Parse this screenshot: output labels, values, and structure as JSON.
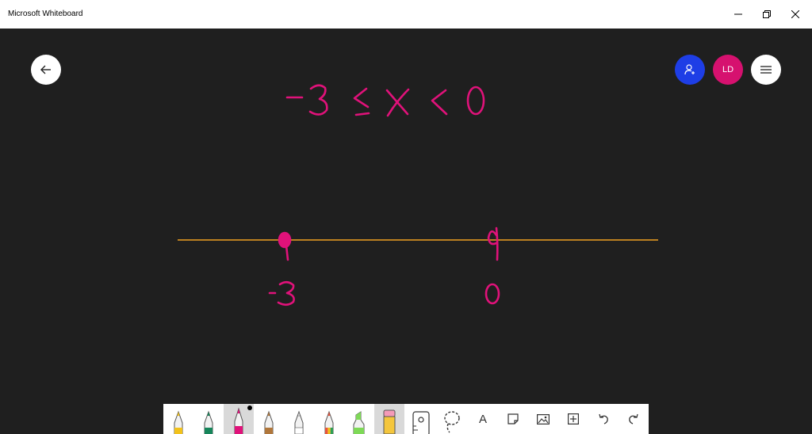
{
  "window": {
    "title": "Microsoft Whiteboard",
    "minimize_icon": "minimize-icon",
    "restore_icon": "restore-icon",
    "close_icon": "close-icon"
  },
  "canvas_controls": {
    "back_icon": "arrow-left-icon",
    "share_icon": "person-add-icon",
    "avatar_initials": "LD",
    "menu_icon": "hamburger-menu-icon"
  },
  "ink": {
    "inequality": "-3 ≤ x < 0",
    "left_label": "-3",
    "right_label": "0",
    "ink_color": "#e0127a",
    "number_line_color": "#f0a020"
  },
  "toolbar": {
    "tools": [
      {
        "name": "pen-yellow",
        "color": "#f2c21b"
      },
      {
        "name": "pen-green",
        "color": "#16855a"
      },
      {
        "name": "pen-pink",
        "color": "#e0127a",
        "selected": true
      },
      {
        "name": "pen-brown",
        "color": "#b0773c"
      },
      {
        "name": "pen-white",
        "color": "#ffffff"
      },
      {
        "name": "pen-rainbow",
        "color": "#e8543c"
      },
      {
        "name": "highlighter-green",
        "color": "#7ed957"
      },
      {
        "name": "eraser",
        "color": "#f4c63d"
      }
    ],
    "ruler_icon": "ruler-icon",
    "lasso_icon": "lasso-icon",
    "text_label": "A",
    "note_icon": "sticky-note-icon",
    "image_icon": "image-icon",
    "add_icon": "plus-box-icon",
    "undo_icon": "undo-icon",
    "redo_icon": "redo-icon"
  }
}
